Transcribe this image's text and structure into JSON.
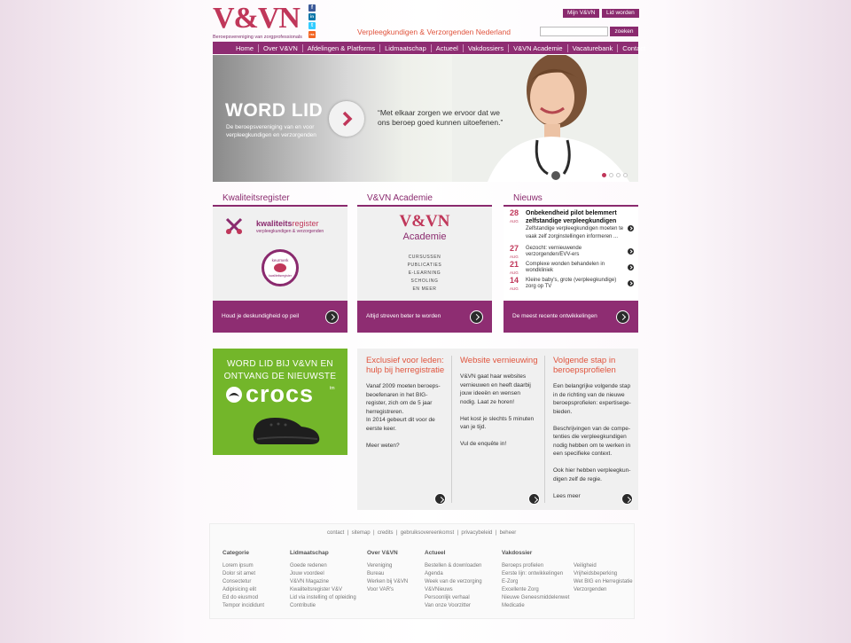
{
  "header": {
    "logo": "V&VN",
    "logo_sub": "Beroepsvereniging van zorgprofessionals",
    "tagline": "Verpleegkundigen & Verzorgenden Nederland",
    "btn_myvvn": "Mijn V&VN",
    "btn_join": "Lid worden",
    "search_placeholder": "",
    "search_btn": "zoeken"
  },
  "social": [
    "f",
    "in",
    "t",
    "rss"
  ],
  "nav": [
    "Home",
    "Over V&VN",
    "Afdelingen & Platforms",
    "Lidmaatschap",
    "Actueel",
    "Vakdossiers",
    "V&VN Academie",
    "Vacaturebank",
    "Contact"
  ],
  "hero": {
    "title": "WORD LID",
    "subtitle": "De beroepsvereniging van en voor verpleegkundigen en verzorgenden",
    "quote": "“Met elkaar zorgen we ervoor dat we ons beroep goed kunnen uitoefenen.”"
  },
  "columns": {
    "kwaliteit": {
      "title": "Kwaliteitsregister",
      "logo_a": "kwaliteits",
      "logo_b": "register",
      "logo_sub": "verpleegkundigen & verzorgenden",
      "badge_top": "keurmerk",
      "badge_bottom": "kwaliteitsregister",
      "foot": "Houd je deskundigheid op peil"
    },
    "academie": {
      "title": "V&VN Academie",
      "logo": "V&VN",
      "logo_sub": "Academie",
      "items": [
        "CURSUSSEN",
        "PUBLICATIES",
        "E-LEARNING",
        "SCHOLING",
        "EN MEER"
      ],
      "foot": "Altijd streven beter te worden"
    },
    "nieuws": {
      "title": "Nieuws",
      "items": [
        {
          "day": "28",
          "month": "AUG",
          "title": "Onbekendheid pilot belemmert zelfstandige verpleegkundigen",
          "text": "Zelfstandige verpleegkundigen moeten te vaak zelf zorginstellingen informeren ..."
        },
        {
          "day": "27",
          "month": "AUG",
          "title": "Gezocht: vernieuwende verzorgenden/EVV-ers",
          "text": ""
        },
        {
          "day": "21",
          "month": "AUG",
          "title": "Complexe wonden behandelen in wondkliniek",
          "text": ""
        },
        {
          "day": "14",
          "month": "AUG",
          "title": "Kleine baby's, grote (verpleegkundige) zorg op TV",
          "text": ""
        }
      ],
      "foot": "De meest recente ontwikkelingen"
    }
  },
  "crocs": {
    "line1": "WORD LID BIJ V&VN EN",
    "line2": "ONTVANG DE NIEUWSTE",
    "brand": "crocs",
    "tm": "tm"
  },
  "info": [
    {
      "title": "Exclusief voor leden: hulp bij herregistratie",
      "text": "Vanaf 2009 moeten beroeps-\nbeoefenaren in het BIG-\nregister, zich om de 5 jaar\nherregistreren.\nIn 2014 gebeurt dit voor de\neerste keer.\n\nMeer weten?"
    },
    {
      "title": "Website vernieuwing",
      "text": "V&VN gaat haar websites\nvernieuwen en heeft daarbij\njouw ideeën en wensen\nnodig. Laat ze horen!\n\nHet kost je slechts 5 minuten\nvan je tijd.\n\nVul de enquête in!"
    },
    {
      "title": "Volgende stap in beroepsprofielen",
      "text": "Een belangrijke volgende stap\nin de richting van de nieuwe\nberoepsprofielen: expertisege-\nbieden.\n\nBeschrijvingen van de compe-\ntenties die verpleegkundigen\nnodig hebben om te werken in\neen specifieke context.\n\nOok hier hebben verpleegkun-\ndigen zelf de regie.\n\nLees meer"
    }
  ],
  "footer": {
    "links": [
      "contact",
      "sitemap",
      "credits",
      "gebruiksovereenkomst",
      "privacybeleid",
      "beheer"
    ],
    "columns": [
      {
        "title": "Categorie",
        "items": [
          "Lorem ipsum",
          "Dolor sit amet",
          "Consectetur",
          "Adipisicing elit",
          "Ed do eiusmod",
          "Tempor incididunt"
        ]
      },
      {
        "title": "Lidmaatschap",
        "items": [
          "Goede redenen",
          "Jouw voordeel",
          "V&VN Magazine",
          "Kwaliteitsregister V&V",
          "Lid via instelling of opleiding",
          "Contributie"
        ]
      },
      {
        "title": "Over V&VN",
        "items": [
          "Vereniging",
          "Bureau",
          "Werken bij V&VN",
          "Voor VAR's"
        ]
      },
      {
        "title": "Actueel",
        "items": [
          "Bestellen & downloaden",
          "Agenda",
          "Week van de verzorging",
          "V&VNieuws",
          "Persoonlijk verhaal",
          "Van onze Voorzitter"
        ]
      },
      {
        "title": "Vakdossier",
        "items": [
          "Beroeps profielen",
          "Eerste lijn: ontwikkelingen",
          "E-Zorg",
          "Excellente Zorg",
          "Nieuwe Geneesmiddelenwet",
          "Medicatie"
        ]
      },
      {
        "title": "",
        "items": [
          "Veiligheid",
          "Vrijheidsbeperking",
          "Wet BIG en Herregistatie",
          "Verzorgenden"
        ]
      }
    ]
  },
  "colors": {
    "brand": "#8e2d72",
    "accent": "#e0543d",
    "logo": "#c0375a",
    "crocs_green": "#73b62a"
  }
}
